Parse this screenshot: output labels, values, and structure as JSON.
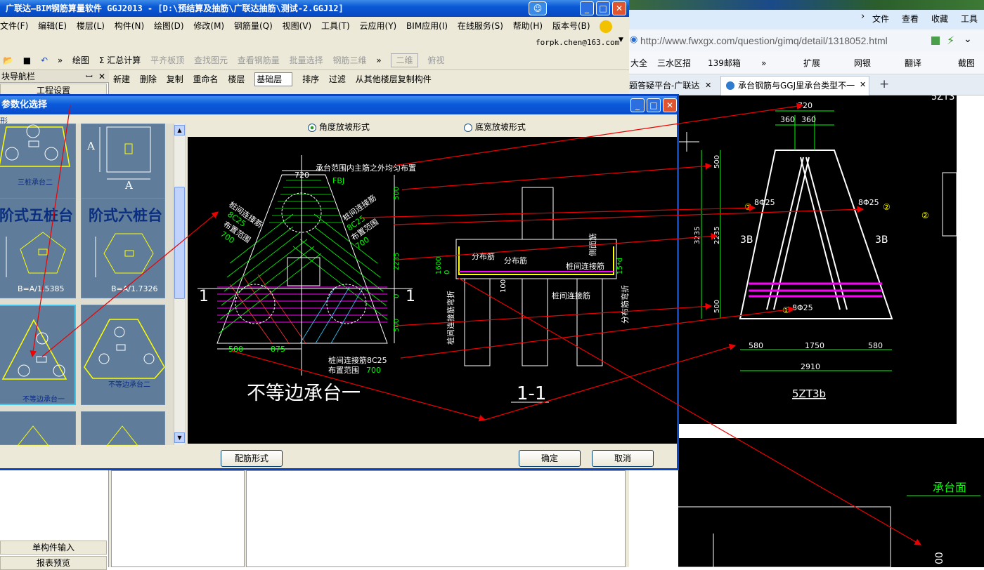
{
  "app": {
    "title": "广联达—BIM钢筋算量软件 GGJ2013 - [D:\\预结算及抽筋\\广联达抽筋\\测试-2.GGJ12]",
    "menu": [
      "文件(F)",
      "编辑(E)",
      "楼层(L)",
      "构件(N)",
      "绘图(D)",
      "修改(M)",
      "钢筋量(Q)",
      "视图(V)",
      "工具(T)",
      "云应用(Y)",
      "BIM应用(I)",
      "在线服务(S)",
      "帮助(H)",
      "版本号(B)"
    ],
    "user": "forpk.chen@163.com",
    "toolbar1": {
      "draw": "绘图",
      "sum": "Σ 汇总计算",
      "flat": "平齐板顶",
      "find": "查找图元",
      "viewrebar": "查看钢筋量",
      "batch": "批量选择",
      "rebar3d": "钢筋三维",
      "view2d": "二维",
      "overlook": "俯视"
    },
    "toolbar2": {
      "new": "新建",
      "delete": "删除",
      "copy": "复制",
      "rename": "重命名",
      "floor_label": "楼层",
      "floor_value": "基础层",
      "sort": "排序",
      "filter": "过滤",
      "copyfrom": "从其他楼层复制构件"
    },
    "nav": {
      "title": "块导航栏",
      "project_settings": "工程设置",
      "single_input": "单构件输入",
      "report": "报表预览"
    }
  },
  "dialog": {
    "title": "参数化选择",
    "left_label": "形",
    "radio_angle": "角度放坡形式",
    "radio_width": "底宽放坡形式",
    "tiles": [
      {
        "caption": "三桩承台二",
        "dim": "A"
      },
      {
        "caption": "",
        "dim": "A"
      },
      {
        "title": "阶式五桩台",
        "formula": "B=A/1.5385"
      },
      {
        "title": "阶式六桩台",
        "formula": "B=A/1.7326"
      },
      {
        "caption": "不等边承台一"
      },
      {
        "caption": "不等边承台二"
      }
    ],
    "buttons": {
      "rebar_form": "配筋形式",
      "ok": "确定",
      "cancel": "取消"
    },
    "drawing": {
      "note_top": "承台范围内主筋之外均匀布置",
      "fbj": "FBJ",
      "left_label1": "桩间连接筋",
      "left_label2": "8C25",
      "left_label3": "布置范围",
      "left_label4": "700",
      "right_label1": "桩间连接筋",
      "right_label2": "8C25",
      "right_label3": "布置范围",
      "right_label4": "700",
      "dim720": "720",
      "dim500a": "500",
      "dim2235": "2235",
      "dim0": "0",
      "dim500b": "500",
      "dim580": "580",
      "dim875": "875",
      "section1": "1",
      "bottom_label1": "桩间连接筋8C25",
      "bottom_label2": "布置范围",
      "bottom_label3": "700",
      "big_title": "不等边承台一",
      "sec_title": "1-1",
      "s_dist1": "分布筋",
      "s_dist2": "分布筋",
      "s_conn": "桩间连接筋",
      "s_conn2": "桩间连接筋",
      "s_side": "侧面筋",
      "s_1600": "1600",
      "s_0": "0",
      "s_100": "100",
      "s_v1": "桩间连接筋弯折",
      "s_v2": "分布筋弯折",
      "s_15d": "15*d"
    }
  },
  "browser": {
    "menu": [
      "文件",
      "查看",
      "收藏",
      "工具"
    ],
    "url": "http://www.fwxgx.com/question/gimq/detail/1318052.html",
    "fav": [
      "大全",
      "三水区招",
      "139邮箱",
      "扩展",
      "网银",
      "翻译",
      "截图"
    ],
    "tabs": [
      "题答疑平台-广联达",
      "承台钢筋与GGJ里承台类型不一"
    ],
    "cad": {
      "d720": "720",
      "d360a": "360",
      "d360b": "360",
      "d500a": "500",
      "d3235": "3235",
      "d2235": "2235",
      "d500b": "500",
      "r1": "8Φ25",
      "r2": "8Φ25",
      "r3": "8Φ25",
      "c2a": "②",
      "c2b": "②",
      "c2c": "②",
      "c1": "①",
      "b3l": "3B",
      "b3r": "3B",
      "d580a": "580",
      "d1750": "1750",
      "d580b": "580",
      "d2910": "2910",
      "name": "5ZT3b",
      "top": "5ZT3",
      "face": "承台面",
      "d00": "00"
    }
  }
}
